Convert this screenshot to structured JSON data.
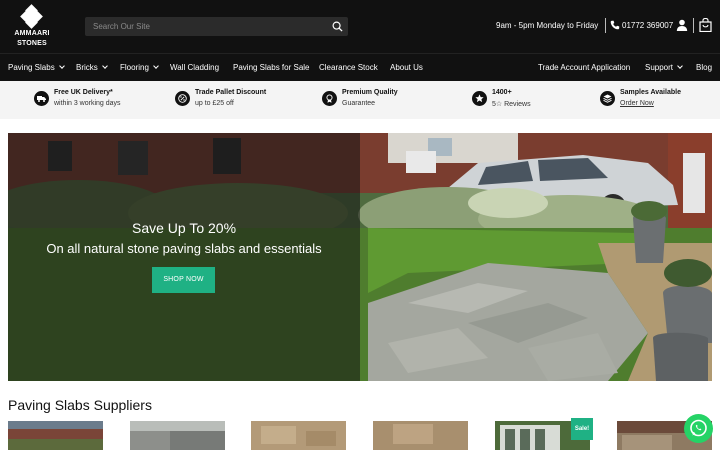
{
  "brand": {
    "line1": "AMMAARI",
    "line2": "STONES"
  },
  "search": {
    "placeholder": "Search Our Site"
  },
  "header": {
    "hours": "9am - 5pm Monday to Friday",
    "phone": "01772 369007"
  },
  "nav": {
    "left": [
      {
        "label": "Paving Slabs",
        "dropdown": true
      },
      {
        "label": "Bricks",
        "dropdown": true
      },
      {
        "label": "Flooring",
        "dropdown": true
      },
      {
        "label": "Wall Cladding",
        "dropdown": false
      },
      {
        "label": "Paving Slabs for Sale",
        "dropdown": false
      },
      {
        "label": "Clearance Stock",
        "dropdown": false
      },
      {
        "label": "About Us",
        "dropdown": false
      }
    ],
    "right": [
      {
        "label": "Trade Account Application",
        "dropdown": false
      },
      {
        "label": "Support",
        "dropdown": true
      },
      {
        "label": "Blog",
        "dropdown": false
      }
    ]
  },
  "usps": [
    {
      "title": "Free UK Delivery*",
      "sub": "within 3 working days",
      "icon": "truck-icon"
    },
    {
      "title": "Trade Pallet Discount",
      "sub": "up to £25 off",
      "icon": "discount-icon"
    },
    {
      "title": "Premium Quality",
      "sub": "Guarantee",
      "icon": "medal-icon"
    },
    {
      "title": "1400+",
      "sub": "5☆ Reviews",
      "icon": "star-icon"
    },
    {
      "title": "Samples Available",
      "sub": "Order Now",
      "icon": "samples-icon"
    }
  ],
  "hero": {
    "title": "Save Up To 20%",
    "subtitle": "On all natural stone paving slabs and essentials",
    "cta": "SHOP NOW"
  },
  "section": {
    "title": "Paving Slabs Suppliers"
  },
  "products": [
    {
      "badge": ""
    },
    {
      "badge": ""
    },
    {
      "badge": ""
    },
    {
      "badge": ""
    },
    {
      "badge": "Sale!"
    },
    {
      "badge": ""
    }
  ],
  "colors": {
    "header_bg": "#111111",
    "accent": "#1fb184",
    "usp_bg": "#f4f4f4",
    "whatsapp": "#25d366"
  }
}
